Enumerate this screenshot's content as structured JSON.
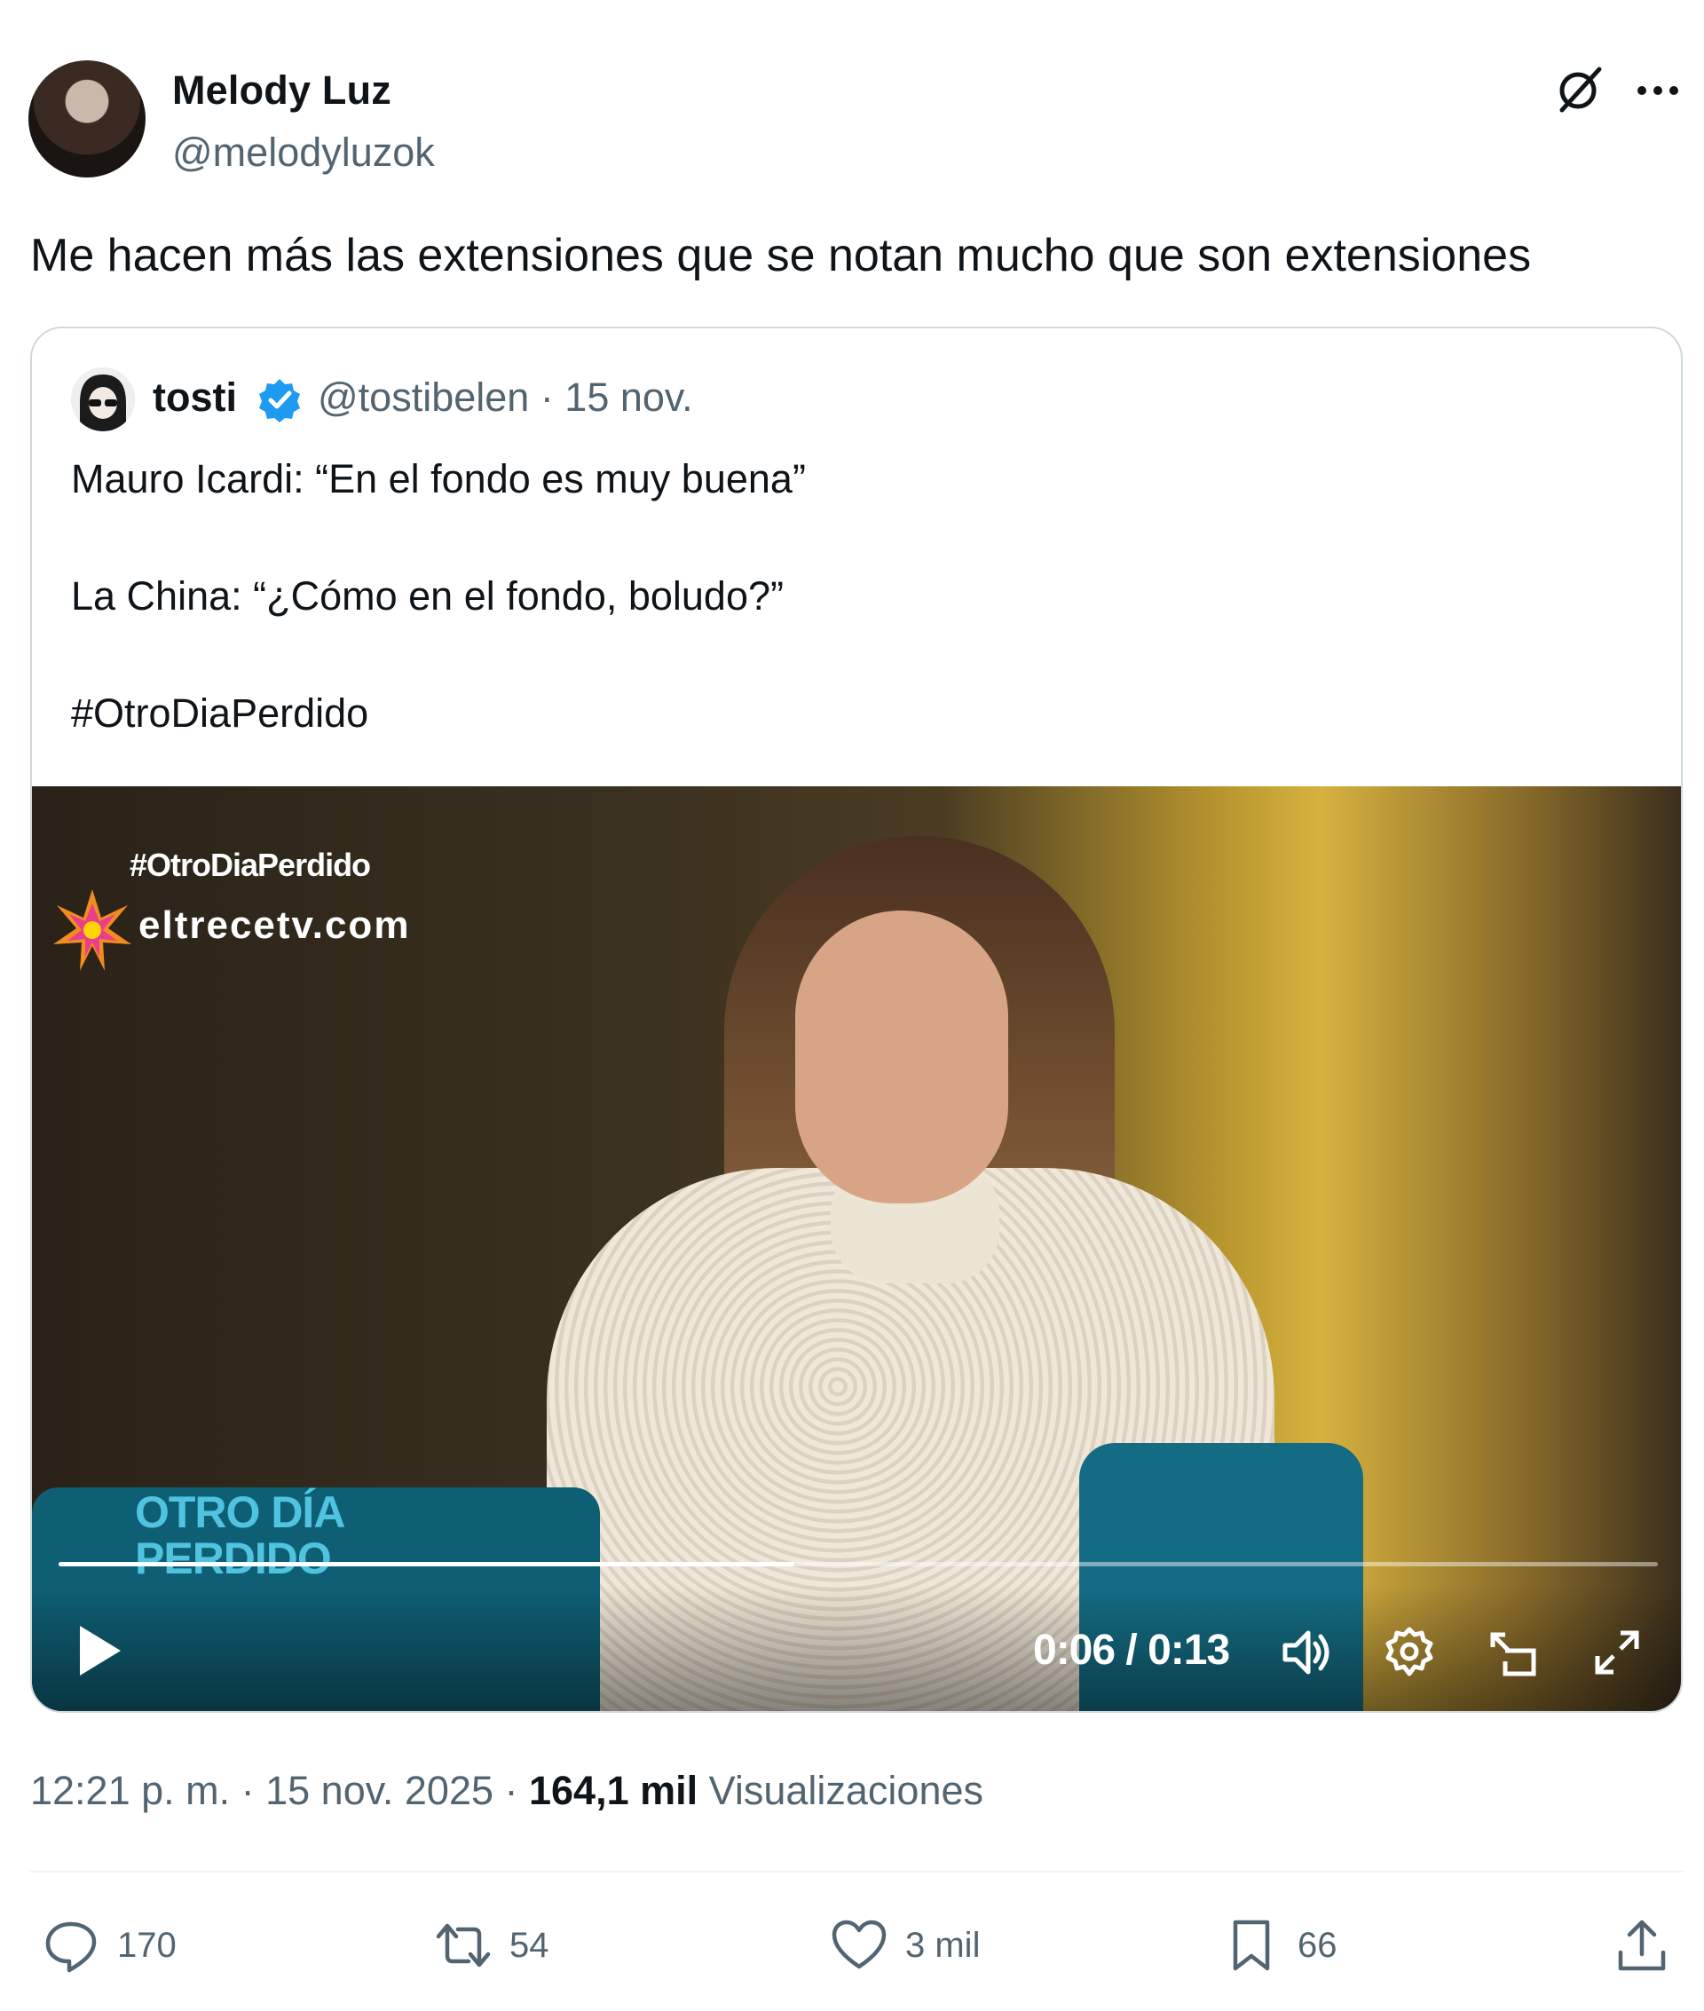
{
  "author": {
    "name": "Melody Luz",
    "handle": "@melodyluzok"
  },
  "tweet": {
    "text": "Me hacen más las extensiones que se notan mucho que son extensiones"
  },
  "quote": {
    "name": "tosti",
    "handle_date": "@tostibelen · 15 nov.",
    "lines": [
      "Mauro Icardi: “En el fondo es muy buena”",
      "La China: “¿Cómo en el fondo, boludo?”",
      "#OtroDiaPerdido"
    ]
  },
  "video": {
    "hashtag": "#OtroDiaPerdido",
    "site": "eltrecetv.com",
    "show_title_1": "OTRO DÍA",
    "show_title_2": "PERDIDO",
    "time": "0:06 / 0:13",
    "progress": 0.46
  },
  "meta": {
    "time_date": "12:21 p. m. · 15 nov. 2025 · ",
    "views_count": "164,1 mil",
    "views_label": "Visualizaciones"
  },
  "actions": {
    "replies": "170",
    "reposts": "54",
    "likes": "3 mil",
    "bookmarks": "66"
  },
  "colors": {
    "text": "#0f1419",
    "muted": "#536471",
    "verified": "#1d9bf0",
    "border": "#cfd9de"
  },
  "icons": [
    "grok-icon",
    "more-icon",
    "verified-icon",
    "play-icon",
    "volume-icon",
    "settings-icon",
    "pip-icon",
    "fullscreen-icon",
    "reply-icon",
    "repost-icon",
    "like-icon",
    "bookmark-icon",
    "share-icon"
  ]
}
